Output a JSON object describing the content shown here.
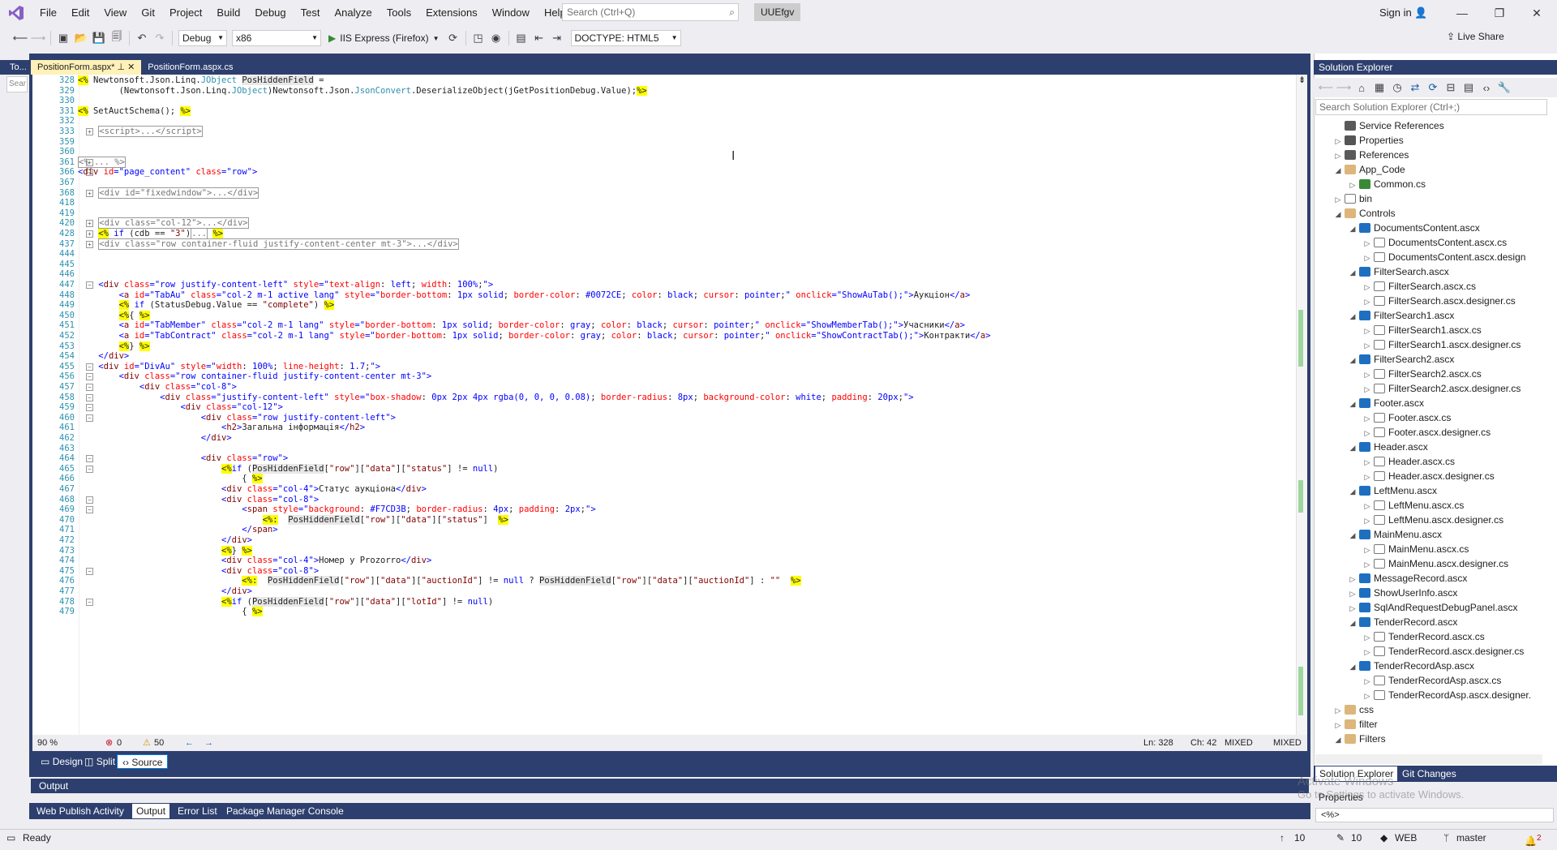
{
  "menu": {
    "items": [
      "File",
      "Edit",
      "View",
      "Git",
      "Project",
      "Build",
      "Debug",
      "Test",
      "Analyze",
      "Tools",
      "Extensions",
      "Window",
      "Help"
    ],
    "search_placeholder": "Search (Ctrl+Q)",
    "solution_name": "UUEfgv",
    "sign_in": "Sign in"
  },
  "toolbar": {
    "config": "Debug",
    "platform": "x86",
    "run_target": "IIS Express (Firefox)",
    "doctype": "DOCTYPE: HTML5",
    "live_share": "Live Share"
  },
  "toolbox": {
    "tab": "To...",
    "search": "Sear"
  },
  "doc_tabs": [
    {
      "label": "PositionForm.aspx*",
      "active": true
    },
    {
      "label": "PositionForm.aspx.cs",
      "active": false
    }
  ],
  "editor": {
    "lines": [
      {
        "n": "328",
        "html": "<span class=\"dlm\">&lt;%</span> Newtonsoft.Json.Linq.<span class=\"typ\">JObject</span> <span class=\"hl\">PosHiddenField</span> ="
      },
      {
        "n": "329",
        "html": "        (Newtonsoft.Json.Linq.<span class=\"typ\">JObject</span>)Newtonsoft.Json.<span class=\"typ\">JsonConvert</span>.DeserializeObject(jGetPositionDebug.Value);<span class=\"dlm\">%&gt;</span>"
      },
      {
        "n": "330",
        "html": ""
      },
      {
        "n": "331",
        "html": "<span class=\"dlm\">&lt;%</span> SetAuctSchema(); <span class=\"dlm\">%&gt;</span>"
      },
      {
        "n": "332",
        "html": ""
      },
      {
        "n": "333",
        "html": "    <span class=\"collapsed\">&lt;script&gt;...&lt;/script&gt;</span>"
      },
      {
        "n": "359",
        "html": ""
      },
      {
        "n": "360",
        "html": ""
      },
      {
        "n": "361",
        "html": "<span class=\"collapsed\">&lt;% ... %&gt;</span>"
      },
      {
        "n": "366",
        "html": "<span class=\"val\">&lt;</span><span class=\"tag\">div</span> <span class=\"attr\">id</span><span class=\"val\">=\"page_content\"</span> <span class=\"attr\">class</span><span class=\"val\">=\"row\"&gt;</span>"
      },
      {
        "n": "367",
        "html": ""
      },
      {
        "n": "368",
        "html": "    <span class=\"collapsed\">&lt;div id=\"fixedwindow\"&gt;...&lt;/div&gt;</span>"
      },
      {
        "n": "418",
        "html": ""
      },
      {
        "n": "419",
        "html": ""
      },
      {
        "n": "420",
        "html": "    <span class=\"collapsed\">&lt;div class=\"col-12\"&gt;...&lt;/div&gt;</span>"
      },
      {
        "n": "428",
        "html": "    <span class=\"dlm\">&lt;%</span> <span class=\"kw\">if</span> (cdb == <span class=\"tag\">\"3\"</span>)<span class=\"collapsed\">...</span> <span class=\"dlm\">%&gt;</span>"
      },
      {
        "n": "437",
        "html": "    <span class=\"collapsed\">&lt;div class=\"row container-fluid justify-content-center mt-3\"&gt;...&lt;/div&gt;</span>"
      },
      {
        "n": "444",
        "html": ""
      },
      {
        "n": "445",
        "html": ""
      },
      {
        "n": "446",
        "html": ""
      },
      {
        "n": "447",
        "html": "    <span class=\"val\">&lt;</span><span class=\"tag\">div</span> <span class=\"attr\">class</span><span class=\"val\">=\"row justify-content-left\"</span> <span class=\"attr\">style</span><span class=\"val\">=\"</span><span class=\"attr\">text-align</span>: <span class=\"val\">left</span>; <span class=\"attr\">width</span>: <span class=\"val\">100%</span>;<span class=\"val\">\"&gt;</span>"
      },
      {
        "n": "448",
        "html": "        <span class=\"val\">&lt;</span><span class=\"tag\">a</span> <span class=\"attr\">id</span><span class=\"val\">=\"TabAu\"</span> <span class=\"attr\">class</span><span class=\"val\">=\"col-2 m-1 active lang\"</span> <span class=\"attr\">style</span><span class=\"val\">=\"</span><span class=\"attr\">border-bottom</span>: <span class=\"val\">1px solid</span>; <span class=\"attr\">border-color</span>: <span class=\"val\">#0072CE</span>; <span class=\"attr\">color</span>: <span class=\"val\">black</span>; <span class=\"attr\">cursor</span>: <span class=\"val\">pointer</span>;<span class=\"val\">\"</span> <span class=\"attr\">onclick</span><span class=\"val\">=\"ShowAuTab();\"&gt;</span>Аукціон<span class=\"val\">&lt;/</span><span class=\"tag\">a</span><span class=\"val\">&gt;</span>"
      },
      {
        "n": "449",
        "html": "        <span class=\"dlm\">&lt;%</span> <span class=\"kw\">if</span> (StatusDebug.Value == <span class=\"tag\">\"complete\"</span>) <span class=\"dlm\">%&gt;</span>"
      },
      {
        "n": "450",
        "html": "        <span class=\"dlm\">&lt;%</span>{ <span class=\"dlm\">%&gt;</span>"
      },
      {
        "n": "451",
        "html": "        <span class=\"val\">&lt;</span><span class=\"tag\">a</span> <span class=\"attr\">id</span><span class=\"val\">=\"TabMember\"</span> <span class=\"attr\">class</span><span class=\"val\">=\"col-2 m-1 lang\"</span> <span class=\"attr\">style</span><span class=\"val\">=\"</span><span class=\"attr\">border-bottom</span>: <span class=\"val\">1px solid</span>; <span class=\"attr\">border-color</span>: <span class=\"val\">gray</span>; <span class=\"attr\">color</span>: <span class=\"val\">black</span>; <span class=\"attr\">cursor</span>: <span class=\"val\">pointer</span>;<span class=\"val\">\"</span> <span class=\"attr\">onclick</span><span class=\"val\">=\"ShowMemberTab();\"&gt;</span>Учасники<span class=\"val\">&lt;/</span><span class=\"tag\">a</span><span class=\"val\">&gt;</span>"
      },
      {
        "n": "452",
        "html": "        <span class=\"val\">&lt;</span><span class=\"tag\">a</span> <span class=\"attr\">id</span><span class=\"val\">=\"TabContract\"</span> <span class=\"attr\">class</span><span class=\"val\">=\"col-2 m-1 lang\"</span> <span class=\"attr\">style</span><span class=\"val\">=\"</span><span class=\"attr\">border-bottom</span>: <span class=\"val\">1px solid</span>; <span class=\"attr\">border-color</span>: <span class=\"val\">gray</span>; <span class=\"attr\">color</span>: <span class=\"val\">black</span>; <span class=\"attr\">cursor</span>: <span class=\"val\">pointer</span>;<span class=\"val\">\"</span> <span class=\"attr\">onclick</span><span class=\"val\">=\"ShowContractTab();\"&gt;</span>Контракти<span class=\"val\">&lt;/</span><span class=\"tag\">a</span><span class=\"val\">&gt;</span>"
      },
      {
        "n": "453",
        "html": "        <span class=\"dlm\">&lt;%</span>} <span class=\"dlm\">%&gt;</span>"
      },
      {
        "n": "454",
        "html": "    <span class=\"val\">&lt;/</span><span class=\"tag\">div</span><span class=\"val\">&gt;</span>"
      },
      {
        "n": "455",
        "html": "    <span class=\"val\">&lt;</span><span class=\"tag\">div</span> <span class=\"attr\">id</span><span class=\"val\">=\"DivAu\"</span> <span class=\"attr\">style</span><span class=\"val\">=\"</span><span class=\"attr\">width</span>: <span class=\"val\">100%</span>; <span class=\"attr\">line-height</span>: <span class=\"val\">1.7</span>;<span class=\"val\">\"&gt;</span>"
      },
      {
        "n": "456",
        "html": "        <span class=\"val\">&lt;</span><span class=\"tag\">div</span> <span class=\"attr\">class</span><span class=\"val\">=\"row container-fluid justify-content-center mt-3\"&gt;</span>"
      },
      {
        "n": "457",
        "html": "            <span class=\"val\">&lt;</span><span class=\"tag\">div</span> <span class=\"attr\">class</span><span class=\"val\">=\"col-8\"&gt;</span>"
      },
      {
        "n": "458",
        "html": "                <span class=\"val\">&lt;</span><span class=\"tag\">div</span> <span class=\"attr\">class</span><span class=\"val\">=\"justify-content-left\"</span> <span class=\"attr\">style</span><span class=\"val\">=\"</span><span class=\"attr\">box-shadow</span>: <span class=\"val\">0px 2px 4px rgba(0, 0, 0, 0.08)</span>; <span class=\"attr\">border-radius</span>: <span class=\"val\">8px</span>; <span class=\"attr\">background-color</span>: <span class=\"val\">white</span>; <span class=\"attr\">padding</span>: <span class=\"val\">20px</span>;<span class=\"val\">\"&gt;</span>"
      },
      {
        "n": "459",
        "html": "                    <span class=\"val\">&lt;</span><span class=\"tag\">div</span> <span class=\"attr\">class</span><span class=\"val\">=\"col-12\"&gt;</span>"
      },
      {
        "n": "460",
        "html": "                        <span class=\"val\">&lt;</span><span class=\"tag\">div</span> <span class=\"attr\">class</span><span class=\"val\">=\"row justify-content-left\"&gt;</span>"
      },
      {
        "n": "461",
        "html": "                            <span class=\"val\">&lt;</span><span class=\"tag\">h2</span><span class=\"val\">&gt;</span>Загальна інформація<span class=\"val\">&lt;/</span><span class=\"tag\">h2</span><span class=\"val\">&gt;</span>"
      },
      {
        "n": "462",
        "html": "                        <span class=\"val\">&lt;/</span><span class=\"tag\">div</span><span class=\"val\">&gt;</span>"
      },
      {
        "n": "463",
        "html": ""
      },
      {
        "n": "464",
        "html": "                        <span class=\"val\">&lt;</span><span class=\"tag\">div</span> <span class=\"attr\">class</span><span class=\"val\">=\"row\"&gt;</span>"
      },
      {
        "n": "465",
        "html": "                            <span class=\"dlm\">&lt;%</span><span class=\"kw\">if</span> (<span class=\"hl\">PosHiddenField</span>[<span class=\"tag\">\"row\"</span>][<span class=\"tag\">\"data\"</span>][<span class=\"tag\">\"status\"</span>] != <span class=\"kw\">null</span>)"
      },
      {
        "n": "466",
        "html": "                                { <span class=\"dlm\">%&gt;</span>"
      },
      {
        "n": "467",
        "html": "                            <span class=\"val\">&lt;</span><span class=\"tag\">div</span> <span class=\"attr\">class</span><span class=\"val\">=\"col-4\"&gt;</span>Статус аукціона<span class=\"val\">&lt;/</span><span class=\"tag\">div</span><span class=\"val\">&gt;</span>"
      },
      {
        "n": "468",
        "html": "                            <span class=\"val\">&lt;</span><span class=\"tag\">div</span> <span class=\"attr\">class</span><span class=\"val\">=\"col-8\"&gt;</span>"
      },
      {
        "n": "469",
        "html": "                                <span class=\"val\">&lt;</span><span class=\"tag\">span</span> <span class=\"attr\">style</span><span class=\"val\">=\"</span><span class=\"attr\">background</span>: <span class=\"val\">#F7CD3B</span>; <span class=\"attr\">border-radius</span>: <span class=\"val\">4px</span>; <span class=\"attr\">padding</span>: <span class=\"val\">2px</span>;<span class=\"val\">\"&gt;</span>"
      },
      {
        "n": "470",
        "html": "                                    <span class=\"dlm\">&lt;%:</span>  <span class=\"hl\">PosHiddenField</span>[<span class=\"tag\">\"row\"</span>][<span class=\"tag\">\"data\"</span>][<span class=\"tag\">\"status\"</span>]  <span class=\"dlm\">%&gt;</span>"
      },
      {
        "n": "471",
        "html": "                                <span class=\"val\">&lt;/</span><span class=\"tag\">span</span><span class=\"val\">&gt;</span>"
      },
      {
        "n": "472",
        "html": "                            <span class=\"val\">&lt;/</span><span class=\"tag\">div</span><span class=\"val\">&gt;</span>"
      },
      {
        "n": "473",
        "html": "                            <span class=\"dlm\">&lt;%</span>} <span class=\"dlm\">%&gt;</span>"
      },
      {
        "n": "474",
        "html": "                            <span class=\"val\">&lt;</span><span class=\"tag\">div</span> <span class=\"attr\">class</span><span class=\"val\">=\"col-4\"&gt;</span>Номер у Prozorro<span class=\"val\">&lt;/</span><span class=\"tag\">div</span><span class=\"val\">&gt;</span>"
      },
      {
        "n": "475",
        "html": "                            <span class=\"val\">&lt;</span><span class=\"tag\">div</span> <span class=\"attr\">class</span><span class=\"val\">=\"col-8\"&gt;</span>"
      },
      {
        "n": "476",
        "html": "                                <span class=\"dlm\">&lt;%:</span>  <span class=\"hl\">PosHiddenField</span>[<span class=\"tag\">\"row\"</span>][<span class=\"tag\">\"data\"</span>][<span class=\"tag\">\"auctionId\"</span>] != <span class=\"kw\">null</span> ? <span class=\"hl\">PosHiddenField</span>[<span class=\"tag\">\"row\"</span>][<span class=\"tag\">\"data\"</span>][<span class=\"tag\">\"auctionId\"</span>] : <span class=\"tag\">\"\"</span>  <span class=\"dlm\">%&gt;</span>"
      },
      {
        "n": "477",
        "html": "                            <span class=\"val\">&lt;/</span><span class=\"tag\">div</span><span class=\"val\">&gt;</span>"
      },
      {
        "n": "478",
        "html": "                            <span class=\"dlm\">&lt;%</span><span class=\"kw\">if</span> (<span class=\"hl\">PosHiddenField</span>[<span class=\"tag\">\"row\"</span>][<span class=\"tag\">\"data\"</span>][<span class=\"tag\">\"lotId\"</span>] != <span class=\"kw\">null</span>)"
      },
      {
        "n": "479",
        "html": "                                { <span class=\"dlm\">%&gt;</span>"
      }
    ]
  },
  "editor_status": {
    "zoom": "90 %",
    "errors": "0",
    "warnings": "50",
    "line": "Ln: 328",
    "col": "Ch: 42",
    "enc1": "MIXED",
    "enc2": "MIXED"
  },
  "view_tabs": [
    "Design",
    "Split",
    "Source"
  ],
  "output": {
    "title": "Output"
  },
  "bottom_tabs": [
    "Web Publish Activity",
    "Output",
    "Error List",
    "Package Manager Console"
  ],
  "solution_explorer": {
    "title": "Solution Explorer",
    "search_placeholder": "Search Solution Explorer (Ctrl+;)",
    "items": [
      {
        "label": "Service References",
        "depth": 0,
        "exp": "",
        "icon": "ref"
      },
      {
        "label": "Properties",
        "depth": 0,
        "exp": "▷",
        "icon": "prop"
      },
      {
        "label": "References",
        "depth": 0,
        "exp": "▷",
        "icon": "ref"
      },
      {
        "label": "App_Code",
        "depth": 0,
        "exp": "◢",
        "icon": "folder"
      },
      {
        "label": "Common.cs",
        "depth": 1,
        "exp": "▷",
        "icon": "cs"
      },
      {
        "label": "bin",
        "depth": 0,
        "exp": "▷",
        "icon": "file"
      },
      {
        "label": "Controls",
        "depth": 0,
        "exp": "◢",
        "icon": "folder"
      },
      {
        "label": "DocumentsContent.ascx",
        "depth": 1,
        "exp": "◢",
        "icon": "ascx"
      },
      {
        "label": "DocumentsContent.ascx.cs",
        "depth": 2,
        "exp": "▷",
        "icon": "file"
      },
      {
        "label": "DocumentsContent.ascx.design",
        "depth": 2,
        "exp": "▷",
        "icon": "file"
      },
      {
        "label": "FilterSearch.ascx",
        "depth": 1,
        "exp": "◢",
        "icon": "ascx"
      },
      {
        "label": "FilterSearch.ascx.cs",
        "depth": 2,
        "exp": "▷",
        "icon": "file"
      },
      {
        "label": "FilterSearch.ascx.designer.cs",
        "depth": 2,
        "exp": "▷",
        "icon": "file"
      },
      {
        "label": "FilterSearch1.ascx",
        "depth": 1,
        "exp": "◢",
        "icon": "ascx"
      },
      {
        "label": "FilterSearch1.ascx.cs",
        "depth": 2,
        "exp": "▷",
        "icon": "file"
      },
      {
        "label": "FilterSearch1.ascx.designer.cs",
        "depth": 2,
        "exp": "▷",
        "icon": "file"
      },
      {
        "label": "FilterSearch2.ascx",
        "depth": 1,
        "exp": "◢",
        "icon": "ascx"
      },
      {
        "label": "FilterSearch2.ascx.cs",
        "depth": 2,
        "exp": "▷",
        "icon": "file"
      },
      {
        "label": "FilterSearch2.ascx.designer.cs",
        "depth": 2,
        "exp": "▷",
        "icon": "file"
      },
      {
        "label": "Footer.ascx",
        "depth": 1,
        "exp": "◢",
        "icon": "ascx"
      },
      {
        "label": "Footer.ascx.cs",
        "depth": 2,
        "exp": "▷",
        "icon": "file"
      },
      {
        "label": "Footer.ascx.designer.cs",
        "depth": 2,
        "exp": "▷",
        "icon": "file"
      },
      {
        "label": "Header.ascx",
        "depth": 1,
        "exp": "◢",
        "icon": "ascx"
      },
      {
        "label": "Header.ascx.cs",
        "depth": 2,
        "exp": "▷",
        "icon": "file"
      },
      {
        "label": "Header.ascx.designer.cs",
        "depth": 2,
        "exp": "▷",
        "icon": "file"
      },
      {
        "label": "LeftMenu.ascx",
        "depth": 1,
        "exp": "◢",
        "icon": "ascx"
      },
      {
        "label": "LeftMenu.ascx.cs",
        "depth": 2,
        "exp": "▷",
        "icon": "file"
      },
      {
        "label": "LeftMenu.ascx.designer.cs",
        "depth": 2,
        "exp": "▷",
        "icon": "file"
      },
      {
        "label": "MainMenu.ascx",
        "depth": 1,
        "exp": "◢",
        "icon": "ascx"
      },
      {
        "label": "MainMenu.ascx.cs",
        "depth": 2,
        "exp": "▷",
        "icon": "file"
      },
      {
        "label": "MainMenu.ascx.designer.cs",
        "depth": 2,
        "exp": "▷",
        "icon": "file"
      },
      {
        "label": "MessageRecord.ascx",
        "depth": 1,
        "exp": "▷",
        "icon": "ascx"
      },
      {
        "label": "ShowUserInfo.ascx",
        "depth": 1,
        "exp": "▷",
        "icon": "ascx"
      },
      {
        "label": "SqlAndRequestDebugPanel.ascx",
        "depth": 1,
        "exp": "▷",
        "icon": "ascx"
      },
      {
        "label": "TenderRecord.ascx",
        "depth": 1,
        "exp": "◢",
        "icon": "ascx"
      },
      {
        "label": "TenderRecord.ascx.cs",
        "depth": 2,
        "exp": "▷",
        "icon": "file"
      },
      {
        "label": "TenderRecord.ascx.designer.cs",
        "depth": 2,
        "exp": "▷",
        "icon": "file"
      },
      {
        "label": "TenderRecordAsp.ascx",
        "depth": 1,
        "exp": "◢",
        "icon": "ascx"
      },
      {
        "label": "TenderRecordAsp.ascx.cs",
        "depth": 2,
        "exp": "▷",
        "icon": "file"
      },
      {
        "label": "TenderRecordAsp.ascx.designer.",
        "depth": 2,
        "exp": "▷",
        "icon": "file"
      },
      {
        "label": "css",
        "depth": 0,
        "exp": "▷",
        "icon": "folder"
      },
      {
        "label": "filter",
        "depth": 0,
        "exp": "▷",
        "icon": "folder"
      },
      {
        "label": "Filters",
        "depth": 0,
        "exp": "◢",
        "icon": "folder"
      }
    ],
    "tabs": [
      "Solution Explorer",
      "Git Changes"
    ]
  },
  "properties": {
    "title": "Properties",
    "combo": "<%>"
  },
  "watermark": {
    "line1": "Activate Windows",
    "line2": "Go to Settings to activate Windows."
  },
  "statusbar": {
    "ready": "Ready",
    "up": "10",
    "pencil": "10",
    "repo": "WEB",
    "branch": "master",
    "notif": "2"
  }
}
